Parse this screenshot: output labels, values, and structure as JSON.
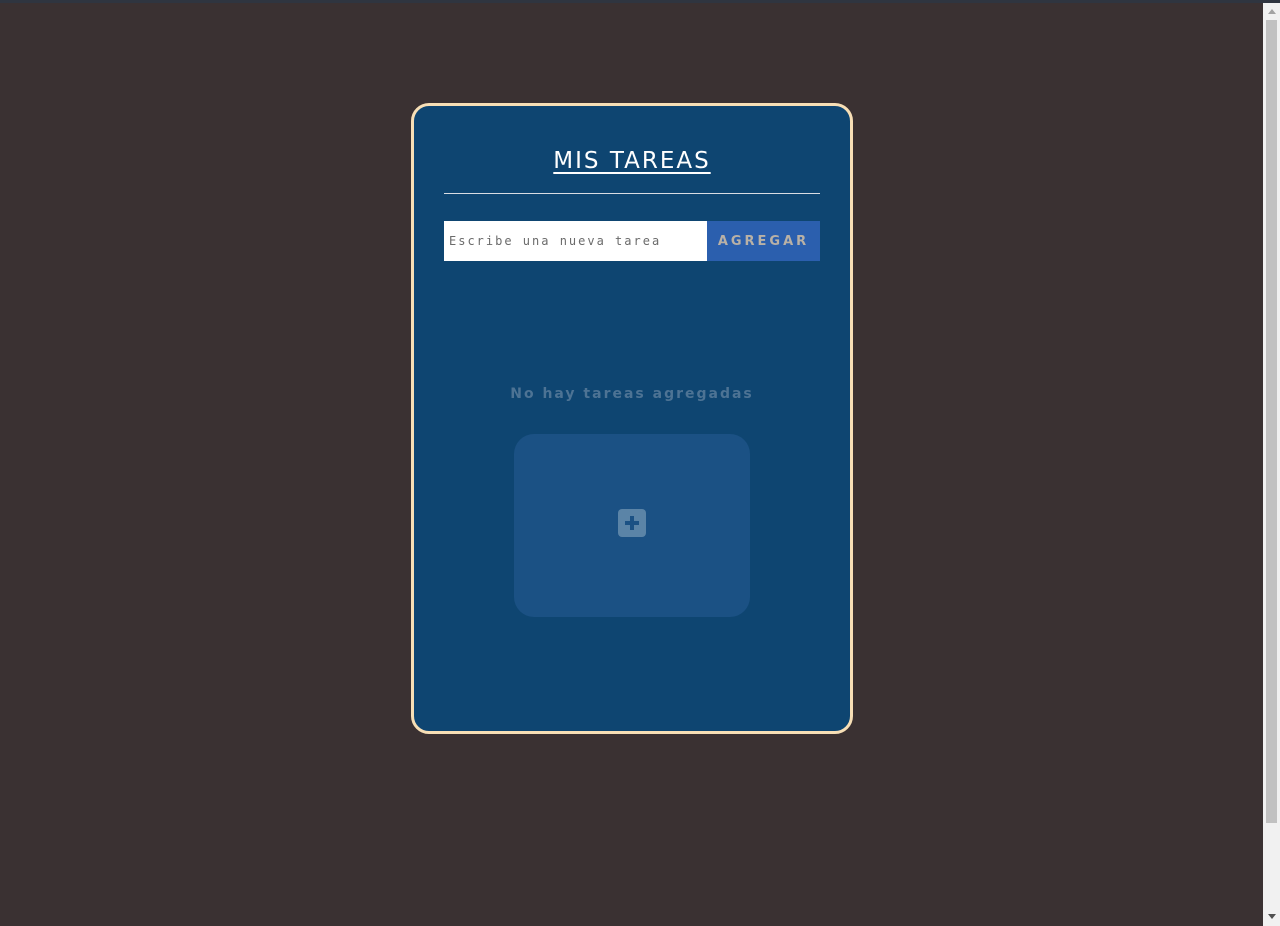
{
  "app": {
    "title": "MIS TAREAS"
  },
  "task_form": {
    "input_value": "",
    "input_placeholder": "Escribe una nueva tarea",
    "add_button_label": "AGREGAR"
  },
  "empty_state": {
    "message": "No hay tareas agregadas",
    "icon": "plus-square-icon"
  },
  "colors": {
    "background": "#3a3132",
    "card": "#0e4571",
    "card_border": "#f7dfb6",
    "button": "#2b5fae",
    "empty_box": "#1b5184"
  }
}
